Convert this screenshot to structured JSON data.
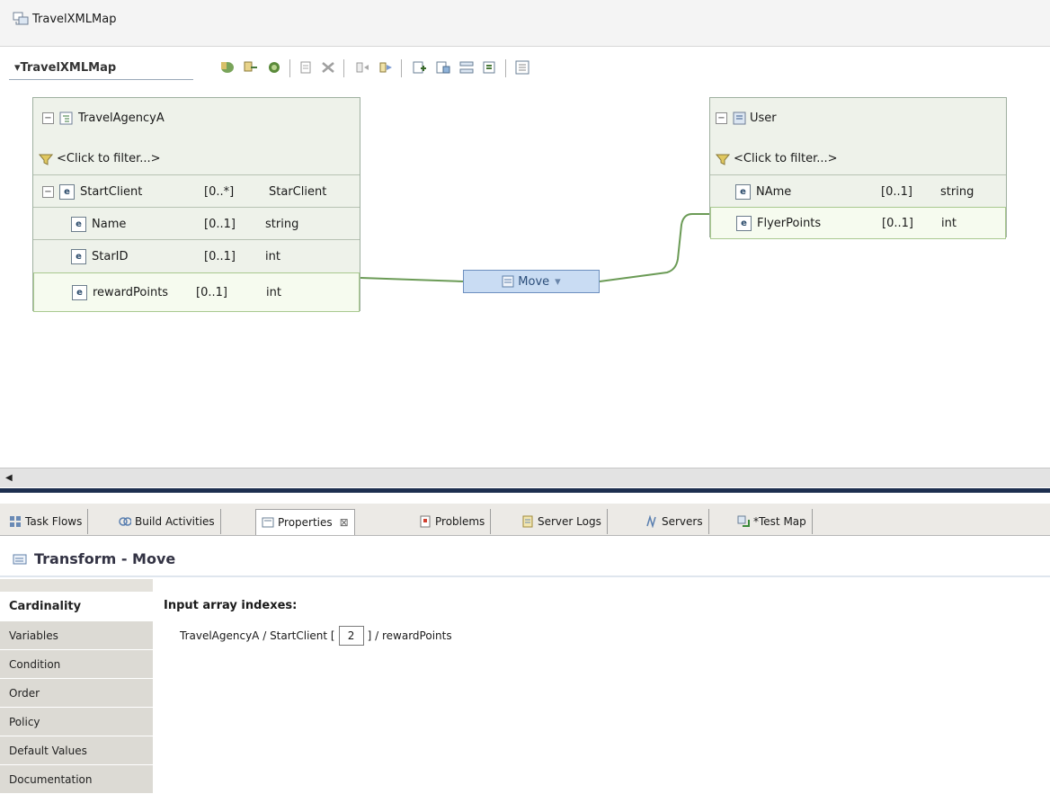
{
  "editor": {
    "tab_title": "TravelXMLMap"
  },
  "map": {
    "root_name": "TravelXMLMap",
    "source": {
      "title": "TravelAgencyA",
      "filter": "<Click to filter...>",
      "rows": [
        {
          "name": "StartClient",
          "card": "[0..*]",
          "type": "StarClient"
        },
        {
          "name": "Name",
          "card": "[0..1]",
          "type": "string"
        },
        {
          "name": "StarID",
          "card": "[0..1]",
          "type": "int"
        },
        {
          "name": "rewardPoints",
          "card": "[0..1]",
          "type": "int"
        }
      ]
    },
    "target": {
      "title": "User",
      "filter": "<Click to filter...>",
      "rows": [
        {
          "name": "NAme",
          "card": "[0..1]",
          "type": "string"
        },
        {
          "name": "FlyerPoints",
          "card": "[0..1]",
          "type": "int"
        }
      ]
    },
    "transform": {
      "label": "Move",
      "dropdown": "▾"
    }
  },
  "views": {
    "tabs": [
      {
        "label": "Task Flows"
      },
      {
        "label": "Build Activities"
      },
      {
        "label": "Properties",
        "close": "⊠"
      },
      {
        "label": "Problems"
      },
      {
        "label": "Server Logs"
      },
      {
        "label": "Servers"
      },
      {
        "label": "*Test Map"
      }
    ]
  },
  "properties": {
    "title": "Transform - Move",
    "side_tabs": [
      "Cardinality",
      "Variables",
      "Condition",
      "Order",
      "Policy",
      "Default Values",
      "Documentation"
    ],
    "active_tab": "Cardinality",
    "array_label": "Input array indexes:",
    "path_prefix": "TravelAgencyA / StartClient [",
    "index_value": "2",
    "path_suffix": "] / rewardPoints"
  },
  "colors": {
    "accent": "#1d2f4f",
    "highlight": "#a9c98f",
    "transform": "#c9dcf3"
  }
}
